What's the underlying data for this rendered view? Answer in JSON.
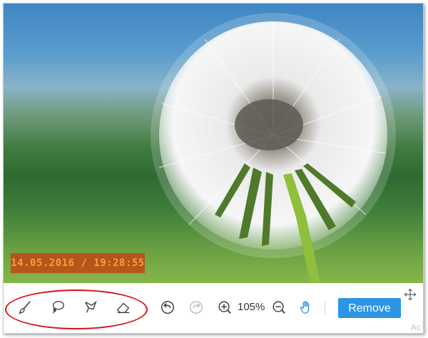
{
  "photo": {
    "timestamp": "14.05.2016 / 19:28:55"
  },
  "toolbar": {
    "tools": [
      {
        "name": "brush-icon"
      },
      {
        "name": "lasso-icon"
      },
      {
        "name": "polygon-lasso-icon"
      },
      {
        "name": "eraser-icon"
      }
    ],
    "undo_icon": "undo-icon",
    "redo_icon": "redo-icon",
    "zoom_in_icon": "zoom-in-icon",
    "zoom_level": "105%",
    "zoom_out_icon": "zoom-out-icon",
    "hand_icon": "hand-icon",
    "remove_label": "Remove",
    "accent_color": "#2b95e6",
    "highlight_color": "#d4141a"
  },
  "watermark": "Ac"
}
